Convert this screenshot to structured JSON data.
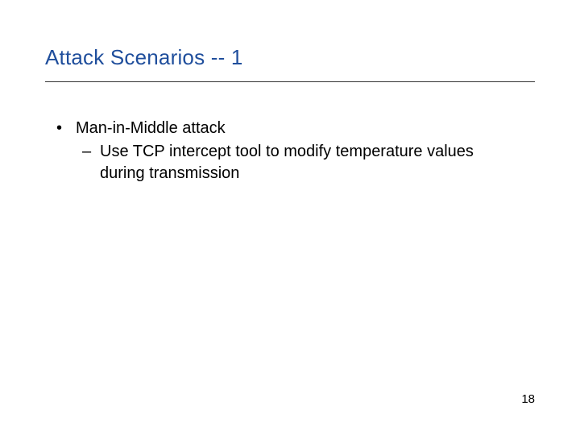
{
  "title": "Attack Scenarios -- 1",
  "bullets": {
    "l1": {
      "marker": "•",
      "text": "Man-in-Middle attack"
    },
    "l2": {
      "marker": "–",
      "text": "Use TCP intercept tool to modify temperature values during transmission"
    }
  },
  "page_number": "18"
}
